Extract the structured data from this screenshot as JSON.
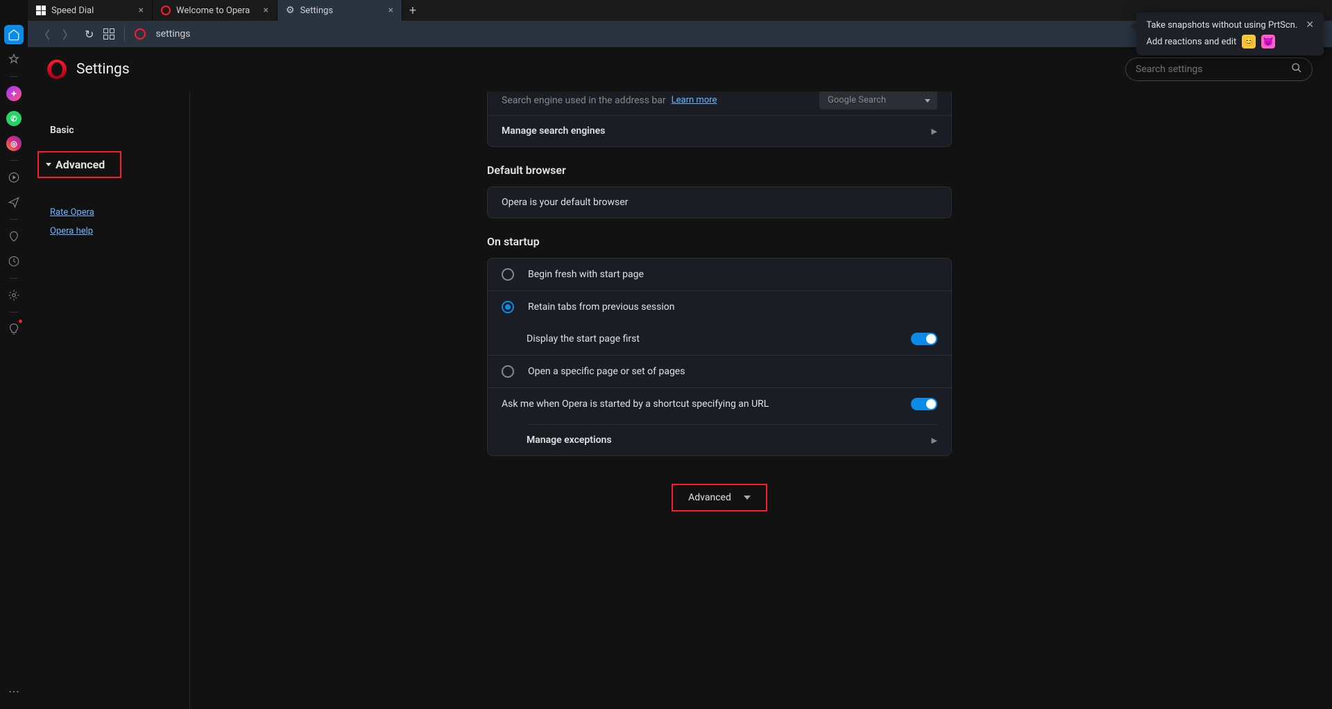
{
  "titlebar": {
    "tabs": [
      {
        "label": "Speed Dial"
      },
      {
        "label": "Welcome to Opera"
      },
      {
        "label": "Settings"
      }
    ]
  },
  "addressbar": {
    "url": "settings"
  },
  "header": {
    "title": "Settings",
    "search_placeholder": "Search settings"
  },
  "sidebar_nav": {
    "basic": "Basic",
    "advanced": "Advanced",
    "rate": "Rate Opera",
    "help": "Opera help"
  },
  "search_engine_section": {
    "row_label": "Search engine used in the address bar",
    "learn_more": "Learn more",
    "selected": "Google Search",
    "manage": "Manage search engines"
  },
  "default_browser": {
    "title": "Default browser",
    "status": "Opera is your default browser"
  },
  "startup": {
    "title": "On startup",
    "opt_fresh": "Begin fresh with start page",
    "opt_retain": "Retain tabs from previous session",
    "opt_retain_sub": "Display the start page first",
    "opt_specific": "Open a specific page or set of pages",
    "ask_shortcut": "Ask me when Opera is started by a shortcut specifying an URL",
    "manage_exceptions": "Manage exceptions"
  },
  "advanced_button": "Advanced",
  "tooltip": {
    "line1": "Take snapshots without using PrtScn.",
    "line2": "Add reactions and edit"
  }
}
